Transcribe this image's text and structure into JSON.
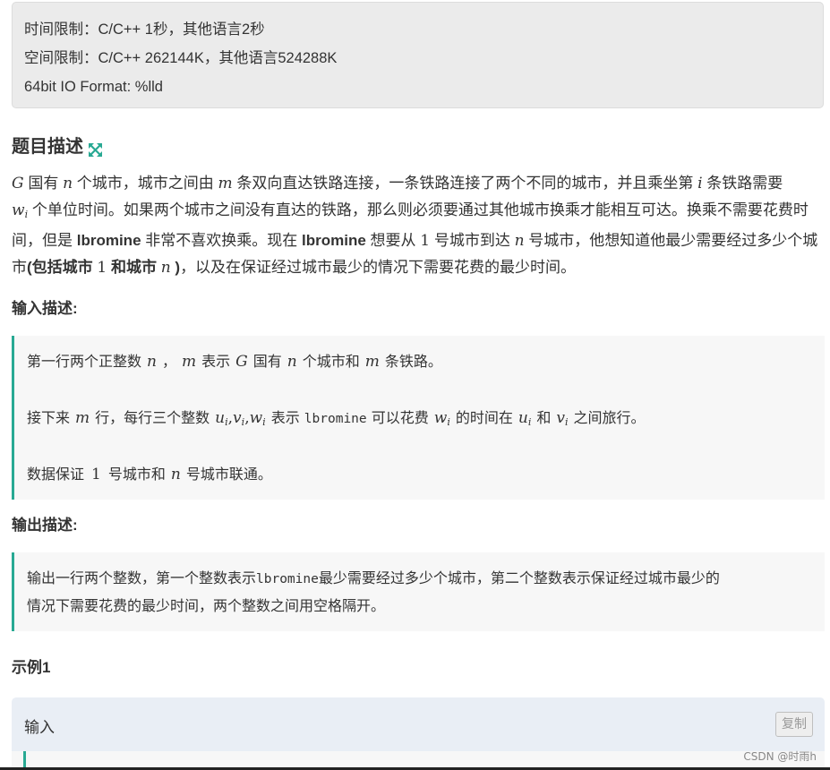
{
  "limits": {
    "time": "时间限制：C/C++ 1秒，其他语言2秒",
    "space": "空间限制：C/C++ 262144K，其他语言524288K",
    "format": "64bit IO Format: %lld"
  },
  "description": {
    "title": "题目描述",
    "expand_icon": "expand-arrows-icon",
    "s1": "国有",
    "s2": "个城市，城市之间由",
    "s3": "条双向直达铁路连接，一条铁路连接了两个不同的城市，并且乘坐第",
    "s4": "条铁路需要",
    "s5": "个单位时间。如果两个城市之间没有直达的铁路，那么则必须要通过其他城市换乘才能相互可达。换乘不需要花费时间，但是",
    "name1": "lbromine",
    "s6": "非常不喜欢换乘。现在",
    "name2": "lbromine",
    "s7": "想要从",
    "s8": "号城市到达",
    "s9": "号城市，他想知道他最少需要经过多少个城市",
    "bold_open": "(包括城市",
    "bold_and": "和城市",
    "bold_close": ")",
    "s10": "，以及在保证经过城市最少的情况下需要花费的最少时间。"
  },
  "math": {
    "G": "G",
    "n": "n",
    "m": "m",
    "i": "i",
    "w": "w",
    "sub_i": "i",
    "one": "1",
    "uvw": "u",
    "v": "v",
    "comma": ","
  },
  "input_section": {
    "title": "输入描述:",
    "l1a": "第一行两个正整数",
    "l1b": "，",
    "l1c": "表示",
    "l1d": "国有",
    "l1e": "个城市和",
    "l1f": "条铁路。",
    "l2a": "接下来",
    "l2b": "行，每行三个整数",
    "l2c": "表示",
    "l2d": "lbromine",
    "l2e": "可以花费",
    "l2f": "的时间在",
    "l2g": "和",
    "l2h": "之间旅行。",
    "l3a": "数据保证",
    "l3b": "号城市和",
    "l3c": "号城市联通。"
  },
  "output_section": {
    "title": "输出描述:",
    "l1a": "输出一行两个整数，第一个整数表示",
    "l1b": "lbromine",
    "l1c": "最少需要经过多少个城市，第二个整数表示保证经过城市最少的",
    "l2": "情况下需要花费的最少时间，两个整数之间用空格隔开。"
  },
  "example": {
    "title": "示例1",
    "input_label": "输入",
    "copy_label": "复制"
  },
  "watermark": "CSDN @时雨h",
  "colors": {
    "accent": "#28a993",
    "limits_bg": "#ebebeb",
    "block_bg": "#f7f7f7",
    "example_header_bg": "#e9eef5"
  }
}
